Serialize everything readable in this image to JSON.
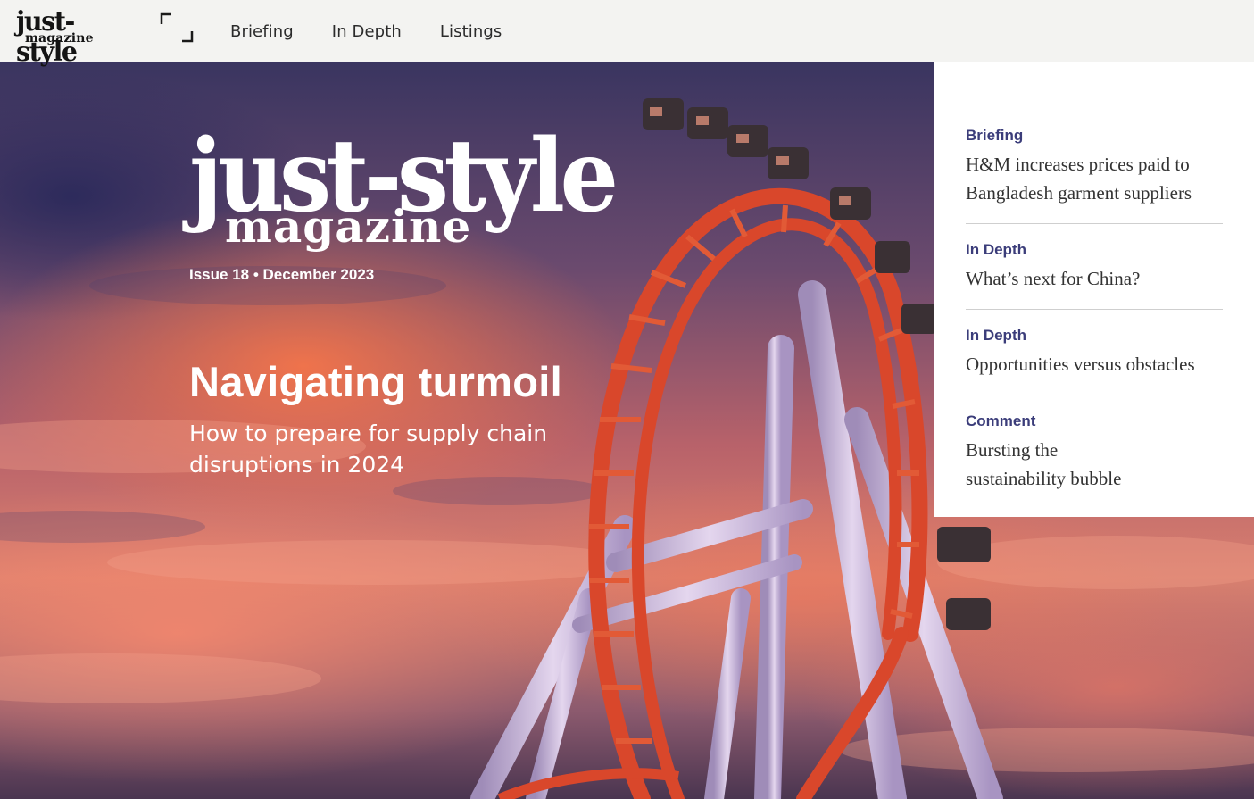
{
  "header": {
    "logo_main": "just-style",
    "logo_sub": "magazine",
    "nav": [
      "Briefing",
      "In Depth",
      "Listings"
    ]
  },
  "hero": {
    "logo_main": "just-style",
    "logo_sub": "magazine",
    "issue": "Issue 18 • December 2023",
    "headline": "Navigating turmoil",
    "subhead": "How to prepare for supply chain disruptions in 2024"
  },
  "contents": [
    {
      "category": "Briefing",
      "title": "H&M increases prices paid to Bangladesh garment suppliers"
    },
    {
      "category": "In Depth",
      "title": "What’s next for China?"
    },
    {
      "category": "In Depth",
      "title": "Opportunities versus obstacles"
    },
    {
      "category": "Comment",
      "title": "Bursting the sustainability bubble"
    }
  ],
  "colors": {
    "accent": "#3b3d7a",
    "topbar": "#f3f3f1",
    "track": "#d9472b",
    "supports": "#c7b3d6"
  }
}
